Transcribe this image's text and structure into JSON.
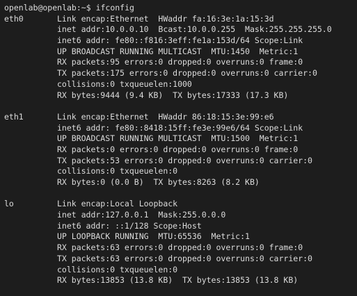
{
  "terminal": {
    "prompt": "openlab@openlab:~$ ",
    "command": "ifconfig",
    "interfaces": [
      {
        "name": "eth0",
        "lines": [
          "Link encap:Ethernet  HWaddr fa:16:3e:1a:15:3d",
          "inet addr:10.0.0.10  Bcast:10.0.0.255  Mask:255.255.255.0",
          "inet6 addr: fe80::f816:3eff:fe1a:153d/64 Scope:Link",
          "UP BROADCAST RUNNING MULTICAST  MTU:1450  Metric:1",
          "RX packets:95 errors:0 dropped:0 overruns:0 frame:0",
          "TX packets:175 errors:0 dropped:0 overruns:0 carrier:0",
          "collisions:0 txqueuelen:1000",
          "RX bytes:9444 (9.4 KB)  TX bytes:17333 (17.3 KB)"
        ]
      },
      {
        "name": "eth1",
        "lines": [
          "Link encap:Ethernet  HWaddr 86:18:15:3e:99:e6",
          "inet6 addr: fe80::8418:15ff:fe3e:99e6/64 Scope:Link",
          "UP BROADCAST RUNNING MULTICAST  MTU:1500  Metric:1",
          "RX packets:0 errors:0 dropped:0 overruns:0 frame:0",
          "TX packets:53 errors:0 dropped:0 overruns:0 carrier:0",
          "collisions:0 txqueuelen:0",
          "RX bytes:0 (0.0 B)  TX bytes:8263 (8.2 KB)"
        ]
      },
      {
        "name": "lo",
        "lines": [
          "Link encap:Local Loopback",
          "inet addr:127.0.0.1  Mask:255.0.0.0",
          "inet6 addr: ::1/128 Scope:Host",
          "UP LOOPBACK RUNNING  MTU:65536  Metric:1",
          "RX packets:63 errors:0 dropped:0 overruns:0 frame:0",
          "TX packets:63 errors:0 dropped:0 overruns:0 carrier:0",
          "collisions:0 txqueuelen:0",
          "RX bytes:13853 (13.8 KB)  TX bytes:13853 (13.8 KB)"
        ]
      }
    ]
  },
  "colors": {
    "background": "#1d1d1d",
    "foreground": "#dcdcdc"
  }
}
